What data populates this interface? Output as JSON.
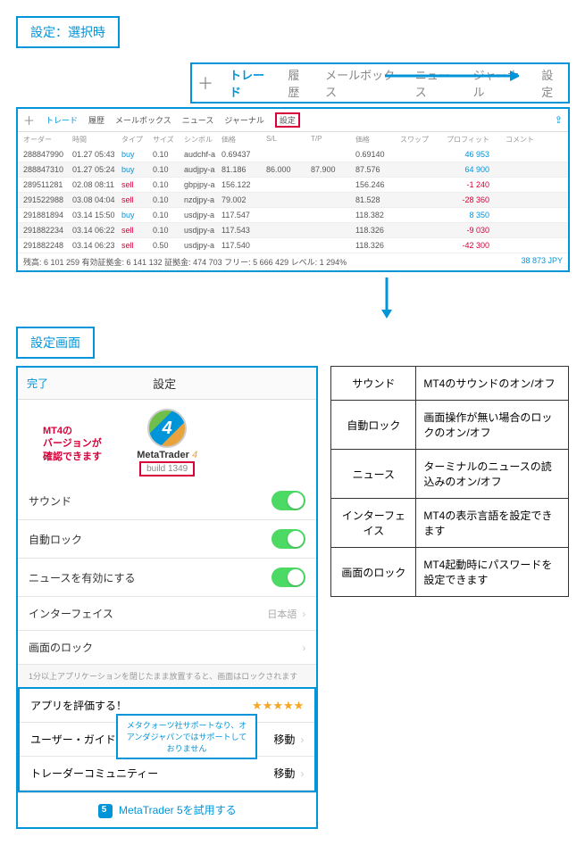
{
  "titles": {
    "select_time": "設定：選択時",
    "settings_screen": "設定画面"
  },
  "tabs_main": {
    "trade": "トレード",
    "history": "履歴",
    "mailbox": "メールボックス",
    "news": "ニュース",
    "journal": "ジャーナル",
    "settings": "設定"
  },
  "trade_panel": {
    "headers": [
      "オーダー",
      "時間",
      "タイプ",
      "サイズ",
      "シンボル",
      "価格",
      "S/L",
      "T/P",
      "価格",
      "スワップ",
      "プロフィット",
      "コメント"
    ],
    "rows": [
      {
        "id": "288847990",
        "time": "01.27 05:43",
        "type": "buy",
        "size": "0.10",
        "sym": "audchf-a",
        "p1": "0.69437",
        "sl": "",
        "tp": "",
        "p2": "0.69140",
        "swap": "",
        "profit": "46 953",
        "cls": "profit-pos"
      },
      {
        "id": "288847310",
        "time": "01.27 05:24",
        "type": "buy",
        "size": "0.10",
        "sym": "audjpy-a",
        "p1": "81.186",
        "sl": "86.000",
        "tp": "87.900",
        "p2": "87.576",
        "swap": "",
        "profit": "64 900",
        "cls": "profit-pos"
      },
      {
        "id": "289511281",
        "time": "02.08 08:11",
        "type": "sell",
        "size": "0.10",
        "sym": "gbpjpy-a",
        "p1": "156.122",
        "sl": "",
        "tp": "",
        "p2": "156.246",
        "swap": "",
        "profit": "-1 240",
        "cls": "profit-neg"
      },
      {
        "id": "291522988",
        "time": "03.08 04:04",
        "type": "sell",
        "size": "0.10",
        "sym": "nzdjpy-a",
        "p1": "79.002",
        "sl": "",
        "tp": "",
        "p2": "81.528",
        "swap": "",
        "profit": "-28 360",
        "cls": "profit-neg"
      },
      {
        "id": "291881894",
        "time": "03.14 15:50",
        "type": "buy",
        "size": "0.10",
        "sym": "usdjpy-a",
        "p1": "117.547",
        "sl": "",
        "tp": "",
        "p2": "118.382",
        "swap": "",
        "profit": "8 350",
        "cls": "profit-pos"
      },
      {
        "id": "291882234",
        "time": "03.14 06:22",
        "type": "sell",
        "size": "0.10",
        "sym": "usdjpy-a",
        "p1": "117.543",
        "sl": "",
        "tp": "",
        "p2": "118.326",
        "swap": "",
        "profit": "-9 030",
        "cls": "profit-neg"
      },
      {
        "id": "291882248",
        "time": "03.14 06:23",
        "type": "sell",
        "size": "0.50",
        "sym": "usdjpy-a",
        "p1": "117.540",
        "sl": "",
        "tp": "",
        "p2": "118.326",
        "swap": "",
        "profit": "-42 300",
        "cls": "profit-neg"
      }
    ],
    "footer_left": "残高: 6 101 259 有効証拠金: 6 141 132 証拠金: 474 703 フリー: 5 666 429 レベル: 1 294%",
    "footer_right": "38 873  JPY"
  },
  "settings": {
    "done": "完了",
    "title": "設定",
    "app_name_a": "MetaTrader",
    "app_name_b": "4",
    "build": "build 1349",
    "version_label_l1": "MT4の",
    "version_label_l2": "バージョンが",
    "version_label_l3": "確認できます",
    "rows": {
      "sound": "サウンド",
      "autolock": "自動ロック",
      "news": "ニュースを有効にする",
      "interface": "インターフェイス",
      "interface_val": "日本語",
      "screenlock": "画面のロック"
    },
    "hint": "1分以上アプリケーションを閉じたまま放置すると、画面はロックされます",
    "rate": "アプリを評価する！",
    "guide": "ユーザー・ガイド",
    "community": "トレーダーコミュニティー",
    "move": "移動",
    "support_note": "メタクォーツ社サポートなり、オアンダジャパンではサポートしておりません",
    "mt5": "MetaTrader 5を試用する"
  },
  "desc_table": [
    {
      "k": "サウンド",
      "v": "MT4のサウンドのオン/オフ"
    },
    {
      "k": "自動ロック",
      "v": "画面操作が無い場合のロックのオン/オフ"
    },
    {
      "k": "ニュース",
      "v": "ターミナルのニュースの読込みのオン/オフ"
    },
    {
      "k": "インターフェイス",
      "v": "MT4の表示言語を設定できます"
    },
    {
      "k": "画面のロック",
      "v": "MT4起動時にパスワードを設定できます"
    }
  ]
}
